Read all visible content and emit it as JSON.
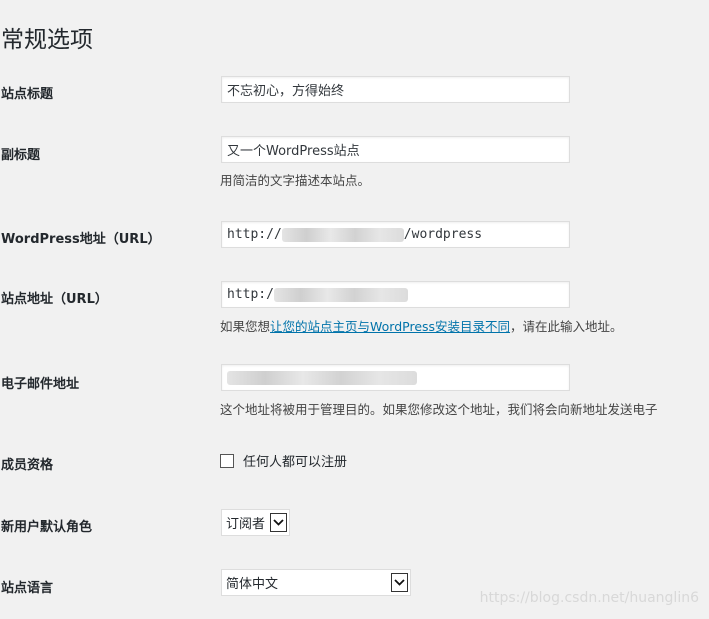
{
  "page": {
    "title": "常规选项"
  },
  "fields": {
    "site_title": {
      "label": "站点标题",
      "value": "不忘初心，方得始终"
    },
    "tagline": {
      "label": "副标题",
      "value": "又一个WordPress站点",
      "description": "用简洁的文字描述本站点。"
    },
    "wp_url": {
      "label": "WordPress地址（URL）",
      "prefix": "http://",
      "suffix": "/wordpress"
    },
    "site_url": {
      "label": "站点地址（URL）",
      "prefix": "http:/",
      "desc_before": "如果您想",
      "desc_link": "让您的站点主页与WordPress安装目录不同",
      "desc_after": "，请在此输入地址。"
    },
    "admin_email": {
      "label": "电子邮件地址",
      "description": "这个地址将被用于管理目的。如果您修改这个地址，我们将会向新地址发送电子"
    },
    "membership": {
      "label": "成员资格",
      "checkbox_label": "任何人都可以注册"
    },
    "default_role": {
      "label": "新用户默认角色",
      "selected": "订阅者"
    },
    "site_language": {
      "label": "站点语言",
      "selected": "简体中文"
    }
  },
  "watermark": "https://blog.csdn.net/huanglin6",
  "icons": {
    "select_arrow": "chevron-down-icon"
  }
}
